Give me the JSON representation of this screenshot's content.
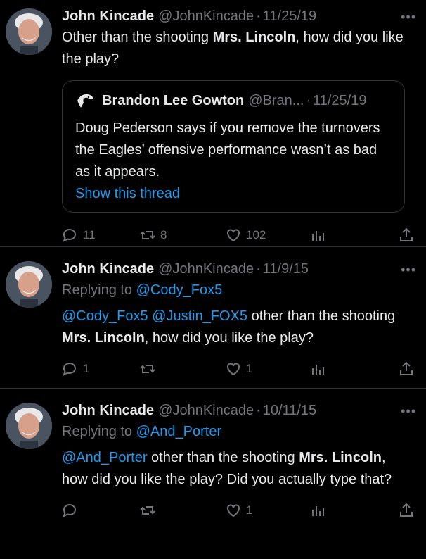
{
  "tweets": [
    {
      "name": "John Kincade",
      "handle": "@JohnKincade",
      "date": "11/25/19",
      "text_a": "Other than the shooting ",
      "text_b": "Mrs. Lincoln",
      "text_c": ", how did you like the play?",
      "quote": {
        "name": "Brandon Lee Gowton",
        "handle": "@Bran...",
        "date": "11/25/19",
        "text": "Doug Pederson says if you remove the turnovers the Eagles’ offensive performance wasn’t as bad as it appears.",
        "show_thread": "Show this thread"
      },
      "replies": "11",
      "retweets": "8",
      "likes": "102"
    },
    {
      "name": "John Kincade",
      "handle": "@JohnKincade",
      "date": "11/9/15",
      "replying_label": "Replying to ",
      "replying_to": "@Cody_Fox5",
      "mention1": "@Cody_Fox5",
      "mention2": "@Justin_FOX5",
      "text_a": " other than the shooting ",
      "text_b": "Mrs. Lincoln",
      "text_c": ", how did you like the play?",
      "replies": "1",
      "retweets": "",
      "likes": "1"
    },
    {
      "name": "John Kincade",
      "handle": "@JohnKincade",
      "date": "10/11/15",
      "replying_label": "Replying to ",
      "replying_to": "@And_Porter",
      "mention1": "@And_Porter",
      "text_a": " other than the shooting ",
      "text_b": "Mrs. Lincoln",
      "text_c": ", how did you like the play? Did you actually type that?",
      "replies": "",
      "retweets": "",
      "likes": "1"
    }
  ],
  "separator": "·",
  "more_icon": "more-dots-icon",
  "colors": {
    "link": "#1d9bf0",
    "muted": "#71767b",
    "text": "#e7e9ea",
    "border": "#2f3336"
  }
}
